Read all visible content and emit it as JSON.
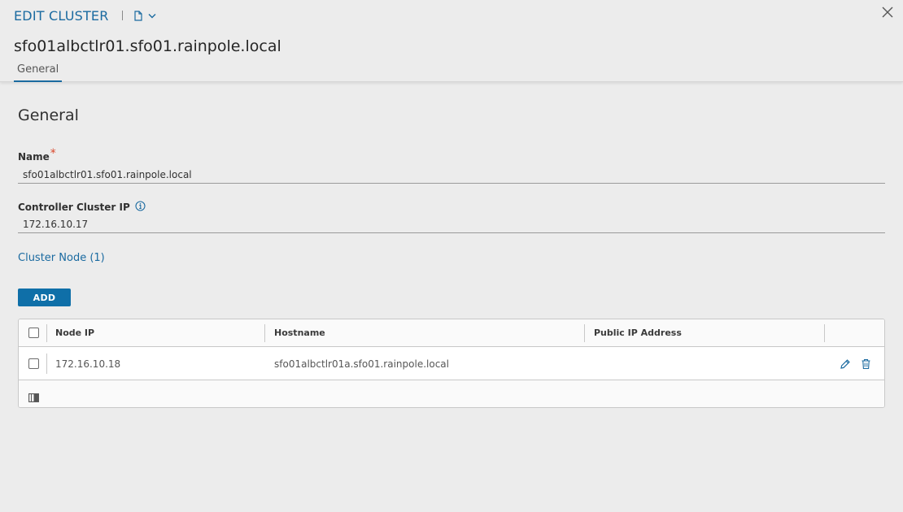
{
  "header": {
    "title": "EDIT CLUSTER",
    "subtitle": "sfo01albctlr01.sfo01.rainpole.local",
    "tab_general": "General",
    "icons": {
      "doc": "document-icon",
      "dropdown": "chevron-down-icon",
      "close": "close-icon"
    }
  },
  "form": {
    "section_title": "General",
    "name_label": "Name",
    "name_required_marker": "*",
    "name_value": "sfo01albctlr01.sfo01.rainpole.local",
    "ip_label": "Controller Cluster IP",
    "ip_value": "172.16.10.17",
    "cluster_node_link": "Cluster Node (1)",
    "add_button": "ADD"
  },
  "grid": {
    "columns": [
      "Node IP",
      "Hostname",
      "Public IP Address"
    ],
    "rows": [
      {
        "node_ip": "172.16.10.18",
        "hostname": "sfo01albctlr01a.sfo01.rainpole.local",
        "public_ip": ""
      }
    ]
  },
  "colors": {
    "accent": "#1a6aa0",
    "button": "#0f6fa8",
    "required": "#d9472b"
  }
}
